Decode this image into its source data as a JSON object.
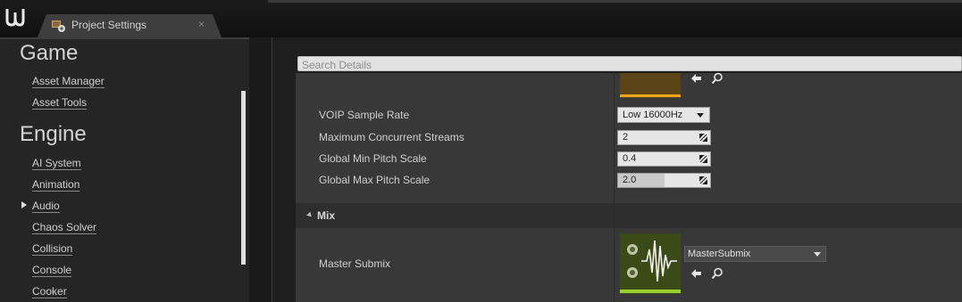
{
  "window": {
    "tab_title": "Project Settings",
    "tab_close": "×"
  },
  "sidebar": {
    "section_game": "Game",
    "game_items": [
      {
        "label": "Asset Manager"
      },
      {
        "label": "Asset Tools"
      }
    ],
    "section_engine": "Engine",
    "engine_items": [
      {
        "label": "AI System"
      },
      {
        "label": "Animation"
      },
      {
        "label": "Audio",
        "selected": true
      },
      {
        "label": "Chaos Solver"
      },
      {
        "label": "Collision"
      },
      {
        "label": "Console"
      },
      {
        "label": "Cooker"
      }
    ]
  },
  "details": {
    "search_placeholder": "Search Details",
    "properties": [
      {
        "label": "VOIP Sample Rate",
        "value": "Low 16000Hz",
        "kind": "combo"
      },
      {
        "label": "Maximum Concurrent Streams",
        "value": "2",
        "kind": "number"
      },
      {
        "label": "Global Min Pitch Scale",
        "value": "0.4",
        "kind": "number"
      },
      {
        "label": "Global Max Pitch Scale",
        "value": "2.0",
        "kind": "number",
        "fill_fraction": 0.5
      }
    ],
    "mix_section": {
      "label": "Mix",
      "master_submix_label": "Master Submix",
      "master_submix_value": "MasterSubmix"
    }
  },
  "colors": {
    "accent_orange": "#e8a317",
    "submix_green": "#3b4a16"
  }
}
